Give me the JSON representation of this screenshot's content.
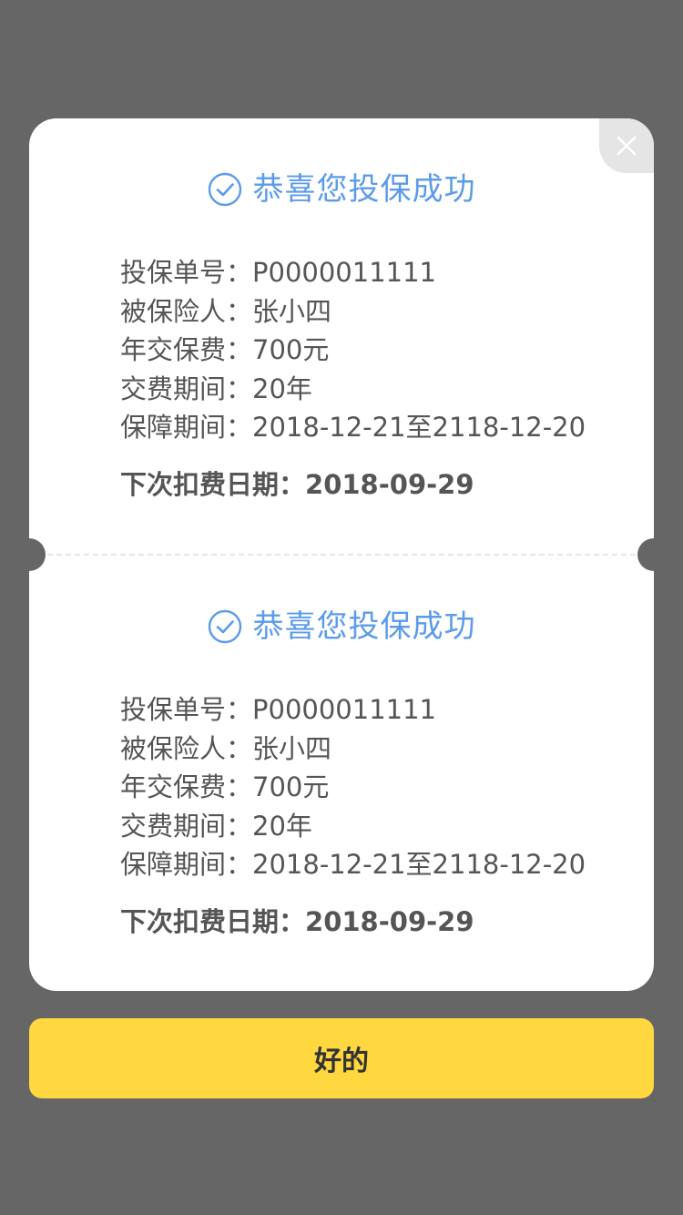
{
  "colors": {
    "overlay": "#666666",
    "accent": "#5b9bea",
    "button": "#ffd83f",
    "text": "#555555"
  },
  "modal": {
    "close_icon": "close-icon",
    "sections": [
      {
        "title": "恭喜您投保成功",
        "icon": "check-circle-icon",
        "rows": [
          {
            "label": "投保单号：",
            "value": "P0000011111"
          },
          {
            "label": "被保险人：",
            "value": "张小四"
          },
          {
            "label": "年交保费：",
            "value": "700元"
          },
          {
            "label": "交费期间：",
            "value": "20年"
          },
          {
            "label": "保障期间：",
            "value": "2018-12-21至2118-12-20"
          }
        ],
        "next_deduction": {
          "label": "下次扣费日期：",
          "value": "2018-09-29"
        }
      },
      {
        "title": "恭喜您投保成功",
        "icon": "check-circle-icon",
        "rows": [
          {
            "label": "投保单号：",
            "value": "P0000011111"
          },
          {
            "label": "被保险人：",
            "value": "张小四"
          },
          {
            "label": "年交保费：",
            "value": "700元"
          },
          {
            "label": "交费期间：",
            "value": "20年"
          },
          {
            "label": "保障期间：",
            "value": "2018-12-21至2118-12-20"
          }
        ],
        "next_deduction": {
          "label": "下次扣费日期：",
          "value": "2018-09-29"
        }
      }
    ]
  },
  "ok_button_label": "好的"
}
